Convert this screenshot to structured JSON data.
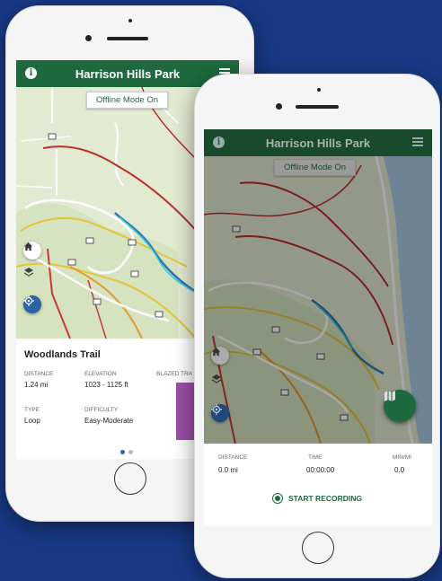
{
  "colors": {
    "brand": "#1e6a3e",
    "background": "#183a86",
    "blazed_swatch": "#9c4fa6"
  },
  "phone1": {
    "appbar": {
      "title": "Harrison Hills Park",
      "info_icon": "i"
    },
    "offline_badge": "Offline Mode On",
    "trail": {
      "name": "Woodlands Trail",
      "distance_label": "DISTANCE",
      "distance_value": "1.24 mi",
      "elevation_label": "ELEVATION",
      "elevation_value": "1023 - 1125 ft",
      "blazed_label": "BLAZED TRA",
      "type_label": "TYPE",
      "type_value": "Loop",
      "difficulty_label": "DIFFICULTY",
      "difficulty_value": "Easy-Moderate"
    },
    "pager": {
      "pages": 2,
      "active": 1
    }
  },
  "phone2": {
    "appbar": {
      "title": "Harrison Hills Park",
      "info_icon": "i"
    },
    "offline_badge": "Offline Mode On",
    "stats": {
      "distance_label": "DISTANCE",
      "distance_value": "0.0 mi",
      "time_label": "TIME",
      "time_value": "00:00:00",
      "minmi_label": "MIN/MI",
      "minmi_value": "0.0"
    },
    "record_label": "START RECORDING"
  }
}
